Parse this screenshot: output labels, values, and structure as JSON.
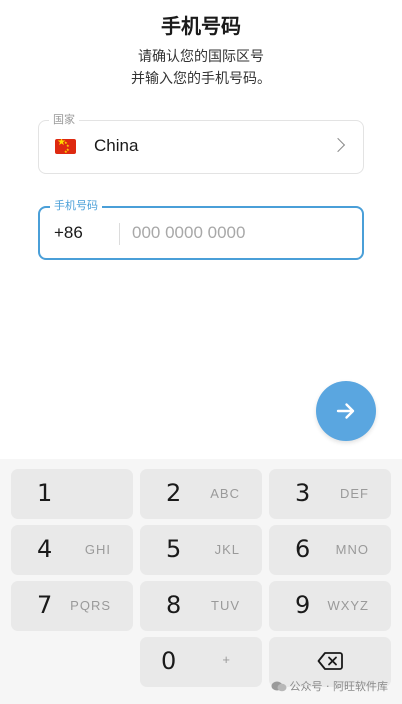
{
  "header": {
    "title": "手机号码",
    "subtitle_line1": "请确认您的国际区号",
    "subtitle_line2": "并输入您的手机号码。"
  },
  "country": {
    "legend": "国家",
    "flag_icon": "china-flag-icon",
    "name": "China"
  },
  "phone": {
    "legend": "手机号码",
    "code": "+86",
    "value": "",
    "placeholder": "000 0000 0000"
  },
  "next_button": {
    "icon": "arrow-right-icon"
  },
  "keypad": {
    "keys": [
      {
        "digit": "1",
        "letters": ""
      },
      {
        "digit": "2",
        "letters": "ABC"
      },
      {
        "digit": "3",
        "letters": "DEF"
      },
      {
        "digit": "4",
        "letters": "GHI"
      },
      {
        "digit": "5",
        "letters": "JKL"
      },
      {
        "digit": "6",
        "letters": "MNO"
      },
      {
        "digit": "7",
        "letters": "PQRS"
      },
      {
        "digit": "8",
        "letters": "TUV"
      },
      {
        "digit": "9",
        "letters": "WXYZ"
      },
      {
        "digit": "0",
        "letters": "+"
      }
    ],
    "backspace_icon": "backspace-icon"
  },
  "watermark": {
    "text": "公众号 · 阿旺软件库",
    "icon": "wechat-icon"
  },
  "colors": {
    "accent": "#4a9fd8",
    "button": "#5aa6e0",
    "key_bg": "#e9e9e9",
    "keypad_bg": "#f6f6f6"
  }
}
